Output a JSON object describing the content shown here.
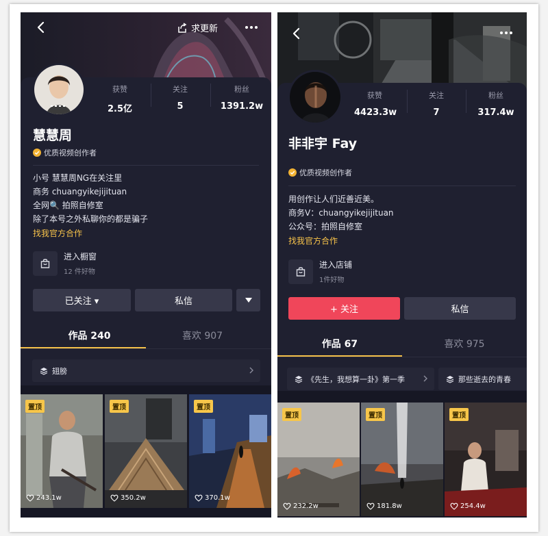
{
  "profile_left": {
    "topbar": {
      "update_label": "求更新"
    },
    "stats": [
      {
        "label": "获赞",
        "value": "2.5亿"
      },
      {
        "label": "关注",
        "value": "5"
      },
      {
        "label": "粉丝",
        "value": "1391.2w"
      }
    ],
    "name": "慧慧周",
    "badge": "优质视频创作者",
    "bio": [
      "小号 慧慧周NG在关注里",
      "商务 chuangyikejijituan",
      "全网🔍 拍照自修室",
      "除了本号之外私聊你的都是骗子"
    ],
    "contact_link": "找我官方合作",
    "shop": {
      "title": "进入橱窗",
      "subtitle": "12 件好物"
    },
    "buttons": {
      "follow": "已关注 ▾",
      "message": "私信"
    },
    "tabs": {
      "works": "作品 240",
      "likes": "喜欢 907"
    },
    "collections": [
      "翅膀"
    ],
    "videos": [
      {
        "pin": "置顶",
        "likes": "243.1w"
      },
      {
        "pin": "置顶",
        "likes": "350.2w"
      },
      {
        "pin": "置顶",
        "likes": "370.1w"
      }
    ]
  },
  "profile_right": {
    "stats": [
      {
        "label": "获赞",
        "value": "4423.3w"
      },
      {
        "label": "关注",
        "value": "7"
      },
      {
        "label": "粉丝",
        "value": "317.4w"
      }
    ],
    "name": "非非宇 Fay",
    "badge": "优质视频创作者",
    "bio": [
      "用创作让人们近善近美。",
      "商务V：chuangyikejijituan",
      "公众号：拍照自修室"
    ],
    "contact_link": "找我官方合作",
    "shop": {
      "title": "进入店铺",
      "subtitle": "1件好物"
    },
    "buttons": {
      "follow": "+ 关注",
      "message": "私信"
    },
    "tabs": {
      "works": "作品 67",
      "likes": "喜欢 975"
    },
    "collections": [
      "《先生，我想算一卦》第一季",
      "那些逝去的青春"
    ],
    "videos": [
      {
        "pin": "置顶",
        "likes": "232.2w"
      },
      {
        "pin": "置顶",
        "likes": "181.8w"
      },
      {
        "pin": "置顶",
        "likes": "254.4w"
      }
    ]
  },
  "colors": {
    "background": "#161724",
    "accent_gold": "#f6c24a",
    "follow_red": "#f0465a"
  },
  "icons": [
    "back-icon",
    "more-icon",
    "share-icon",
    "verified-icon",
    "shopping-bag-icon",
    "dropdown-icon",
    "collection-icon",
    "chevron-right-icon",
    "heart-icon"
  ]
}
